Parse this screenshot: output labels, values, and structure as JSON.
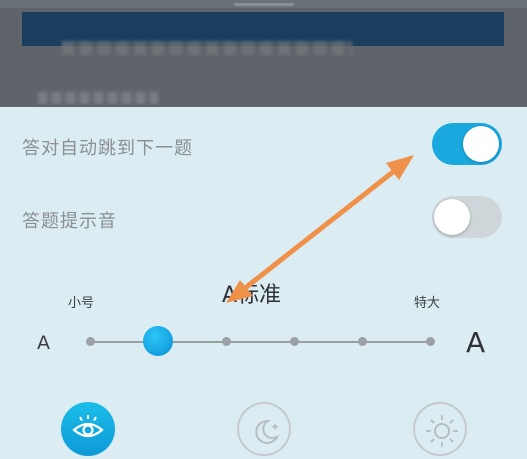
{
  "settings": {
    "auto_next_label": "答对自动跳到下一题",
    "auto_next_on": true,
    "sound_label": "答题提示音",
    "sound_on": false
  },
  "font_size": {
    "current_label": "A标准",
    "small_label": "小号",
    "large_label": "特大",
    "min_glyph": "A",
    "max_glyph": "A",
    "selected_step": 2,
    "step_count": 6
  },
  "modes": [
    {
      "icon": "eye-icon",
      "active": true
    },
    {
      "icon": "moon-icon",
      "active": false
    },
    {
      "icon": "sun-icon",
      "active": false
    }
  ],
  "colors": {
    "accent": "#1aa9df",
    "panel_bg": "#dcecf3",
    "annotation_arrow": "#f0914a"
  }
}
